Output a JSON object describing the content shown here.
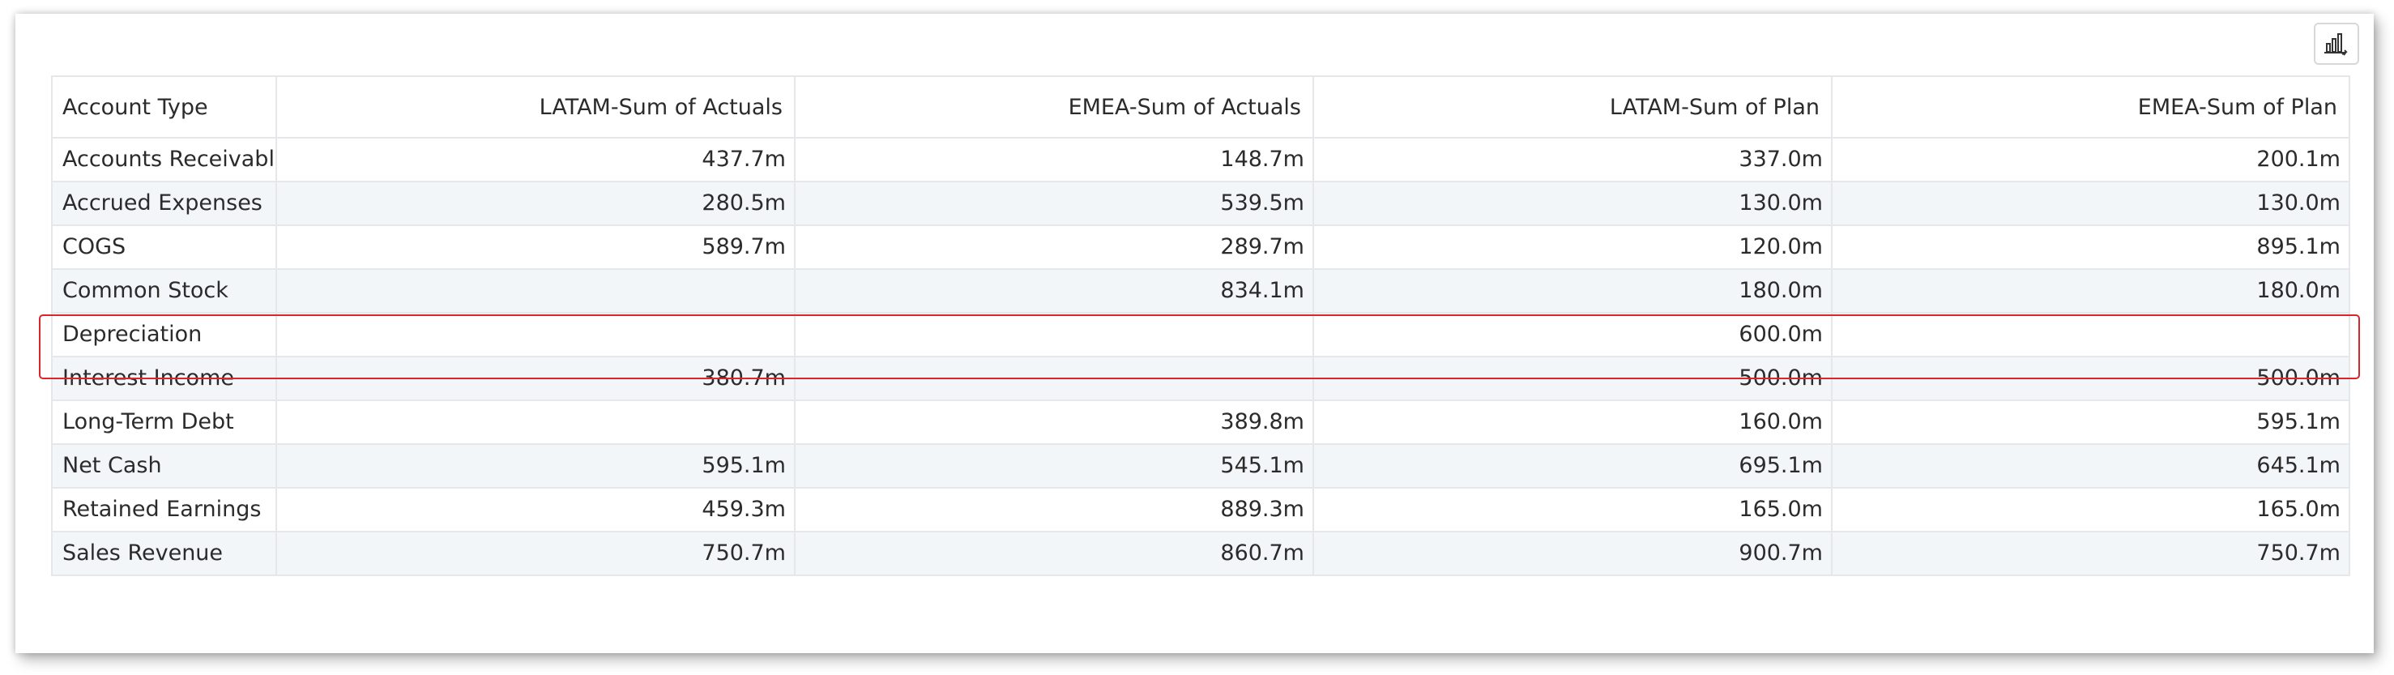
{
  "table": {
    "columns": [
      "Account Type",
      "LATAM-Sum of Actuals",
      "EMEA-Sum of Actuals",
      "LATAM-Sum of Plan",
      "EMEA-Sum of Plan"
    ],
    "rows": [
      [
        "Accounts Receivable",
        "437.7m",
        "148.7m",
        "337.0m",
        "200.1m"
      ],
      [
        "Accrued Expenses",
        "280.5m",
        "539.5m",
        "130.0m",
        "130.0m"
      ],
      [
        "COGS",
        "589.7m",
        "289.7m",
        "120.0m",
        "895.1m"
      ],
      [
        "Common Stock",
        "",
        "834.1m",
        "180.0m",
        "180.0m"
      ],
      [
        "Depreciation",
        "",
        "",
        "600.0m",
        ""
      ],
      [
        "Interest Income",
        "380.7m",
        "",
        "500.0m",
        "500.0m"
      ],
      [
        "Long-Term Debt",
        "",
        "389.8m",
        "160.0m",
        "595.1m"
      ],
      [
        "Net Cash",
        "595.1m",
        "545.1m",
        "695.1m",
        "645.1m"
      ],
      [
        "Retained Earnings",
        "459.3m",
        "889.3m",
        "165.0m",
        "165.0m"
      ],
      [
        "Sales Revenue",
        "750.7m",
        "860.7m",
        "900.7m",
        "750.7m"
      ]
    ],
    "highlighted_row": "Depreciation"
  },
  "toolbar": {
    "chart_button_icon": "bar-chart-icon"
  },
  "colors": {
    "highlight_border": "#d9262b",
    "grid_border": "#e5e7ea",
    "alt_row": "#f3f6f9"
  }
}
